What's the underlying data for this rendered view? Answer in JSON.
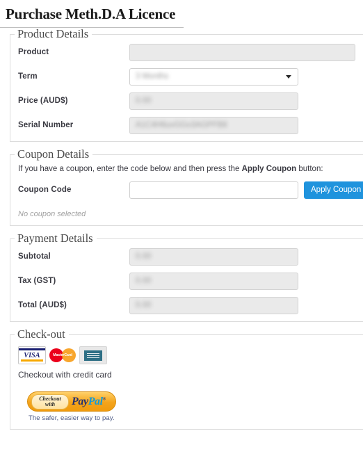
{
  "page": {
    "title": "Purchase Meth.D.A Licence"
  },
  "product_details": {
    "legend": "Product Details",
    "fields": [
      {
        "label": "Product",
        "value": "",
        "redacted": false
      },
      {
        "label": "Term",
        "value": "3 Months",
        "redacted": true
      },
      {
        "label": "Price (AUD$)",
        "value": "0.00",
        "redacted": true
      },
      {
        "label": "Serial Number",
        "value": "A1C4H6uvGGo3AGPFB8",
        "redacted": true
      }
    ]
  },
  "coupon_details": {
    "legend": "Coupon Details",
    "help_prefix": "If you have a coupon, enter the code below and then press the ",
    "help_emphasis": "Apply Coupon",
    "help_suffix": " button:",
    "code_label": "Coupon Code",
    "code_value": "",
    "apply_button": "Apply Coupon",
    "status": "No coupon selected"
  },
  "payment_details": {
    "legend": "Payment Details",
    "fields": [
      {
        "label": "Subtotal",
        "value": "0.00",
        "redacted": true
      },
      {
        "label": "Tax (GST)",
        "value": "0.00",
        "redacted": true
      },
      {
        "label": "Total (AUD$)",
        "value": "0.00",
        "redacted": true
      }
    ]
  },
  "checkout": {
    "legend": "Check-out",
    "cards": [
      {
        "name": "visa-card-icon",
        "text": "VISA"
      },
      {
        "name": "mastercard-card-icon",
        "text": "MasterCard"
      },
      {
        "name": "amex-card-icon",
        "text": "AMERICAN EXPRESS"
      }
    ],
    "credit_card_note": "Checkout with credit card",
    "paypal": {
      "checkout_word": "Checkout",
      "with_word": "with",
      "pay": "Pay",
      "pal": "Pal",
      "tagline": "The safer, easier way to pay."
    }
  },
  "colors": {
    "accent_blue": "#1f93dd",
    "paypal_blue": "#139ad6",
    "paypal_navy": "#26326e",
    "paypal_gold": "#f4a41c",
    "disabled_field": "#eaeaea",
    "border": "#dcdcdc"
  }
}
